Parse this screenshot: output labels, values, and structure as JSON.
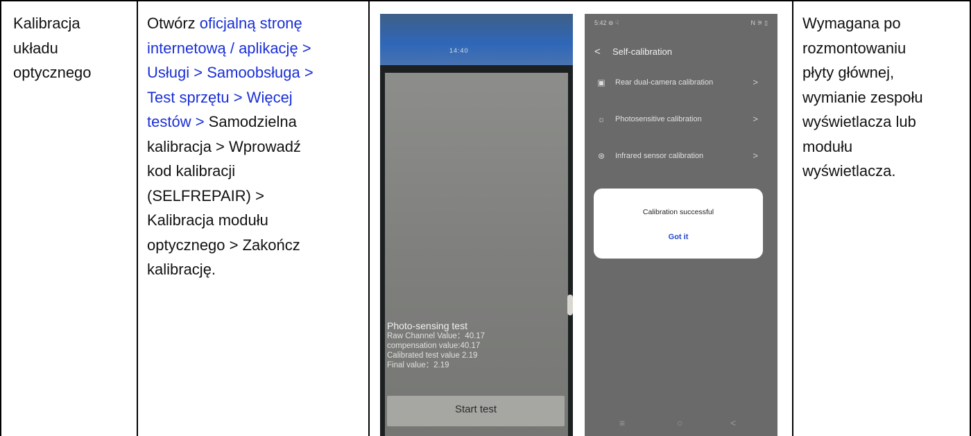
{
  "row": {
    "name_lines": [
      "Kalibracja",
      "układu",
      "optycznego"
    ],
    "procedure": {
      "link_lines": [
        "oficjalną stronę",
        "internetową / aplikację >",
        "Usługi > Samoobsługa >",
        "Test sprzętu > Więcej"
      ],
      "prefix": "Otwórz ",
      "line5_link": "testów > ",
      "line5_rest": "Samodzielna",
      "rest_lines": [
        "kalibracja > Wprowadź",
        "kod kalibracji",
        "(SELFREPAIR) >",
        "Kalibracja modułu",
        "optycznego > Zakończ",
        "kalibrację."
      ]
    },
    "notes_lines": [
      "Wymagana po",
      "rozmontowaniu",
      "płyty głównej,",
      "wymianie zespołu",
      "wyświetlacza lub",
      "modułu",
      "wyświetlacza."
    ]
  },
  "photo_device": {
    "notch_text": "14:40",
    "test_title": "Photo-sensing test",
    "lines": [
      "Raw Channel Value：40.17",
      "compensation value:40.17",
      "Calibrated test value 2.19",
      "Final value：2.19"
    ],
    "button": "Start test"
  },
  "photo_screenshot": {
    "status_left": "5:42 ⊚ ☟",
    "status_right": "N ⚞ ▯",
    "back": "<",
    "title": "Self-calibration",
    "items": [
      {
        "icon": "camera-icon",
        "glyph": "▣",
        "label": "Rear dual-camera calibration",
        "chevron": ">"
      },
      {
        "icon": "sun-icon",
        "glyph": "☼",
        "label": "Photosensitive calibration",
        "chevron": ">"
      },
      {
        "icon": "infrared-icon",
        "glyph": "⊛",
        "label": "Infrared sensor calibration",
        "chevron": ">"
      }
    ],
    "dialog_message": "Calibration successful",
    "dialog_button": "Got it",
    "nav": [
      "≡",
      "○",
      "<"
    ]
  },
  "colors": {
    "link": "#1a2fd6",
    "border": "#000000"
  }
}
